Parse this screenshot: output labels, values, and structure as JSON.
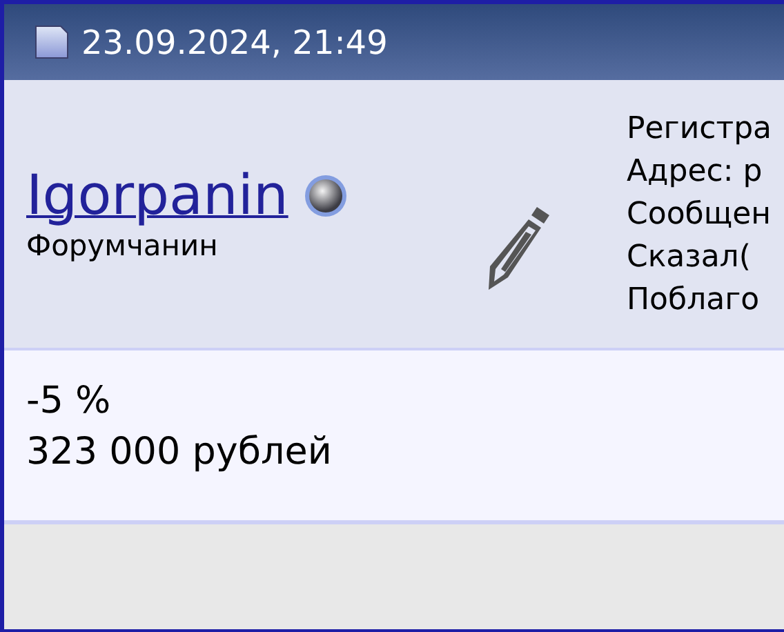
{
  "post_header": {
    "date": "23.09.2024, 21:49"
  },
  "author": {
    "username": "Igorpanin",
    "online": false,
    "rank": "Форумчанин"
  },
  "author_info": [
    "Регистра",
    "Адрес: р",
    "Сообщен",
    "Сказал(",
    "Поблаго"
  ],
  "message": [
    "-5 %",
    "323 000 рублей"
  ]
}
